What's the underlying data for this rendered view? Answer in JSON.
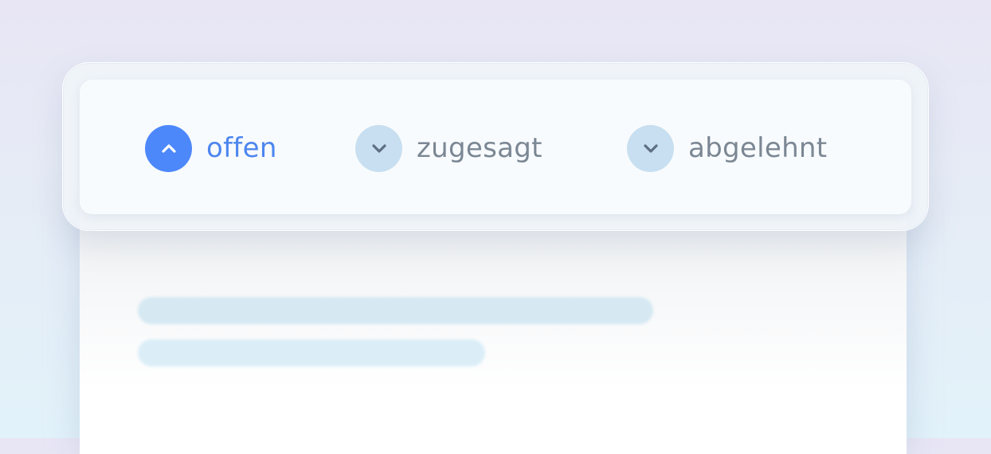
{
  "status_filter": {
    "options": [
      {
        "label": "offen",
        "state": "active",
        "icon": "chevron-up-icon"
      },
      {
        "label": "zugesagt",
        "state": "inactive",
        "icon": "chevron-down-icon"
      },
      {
        "label": "abgelehnt",
        "state": "inactive",
        "icon": "chevron-down-icon"
      }
    ]
  },
  "colors": {
    "active_accent": "#4d88fb",
    "active_text": "#4d86ef",
    "inactive_circle": "#c7dff0",
    "inactive_text": "#7b8794",
    "chevron_inactive": "#5e6f82"
  }
}
